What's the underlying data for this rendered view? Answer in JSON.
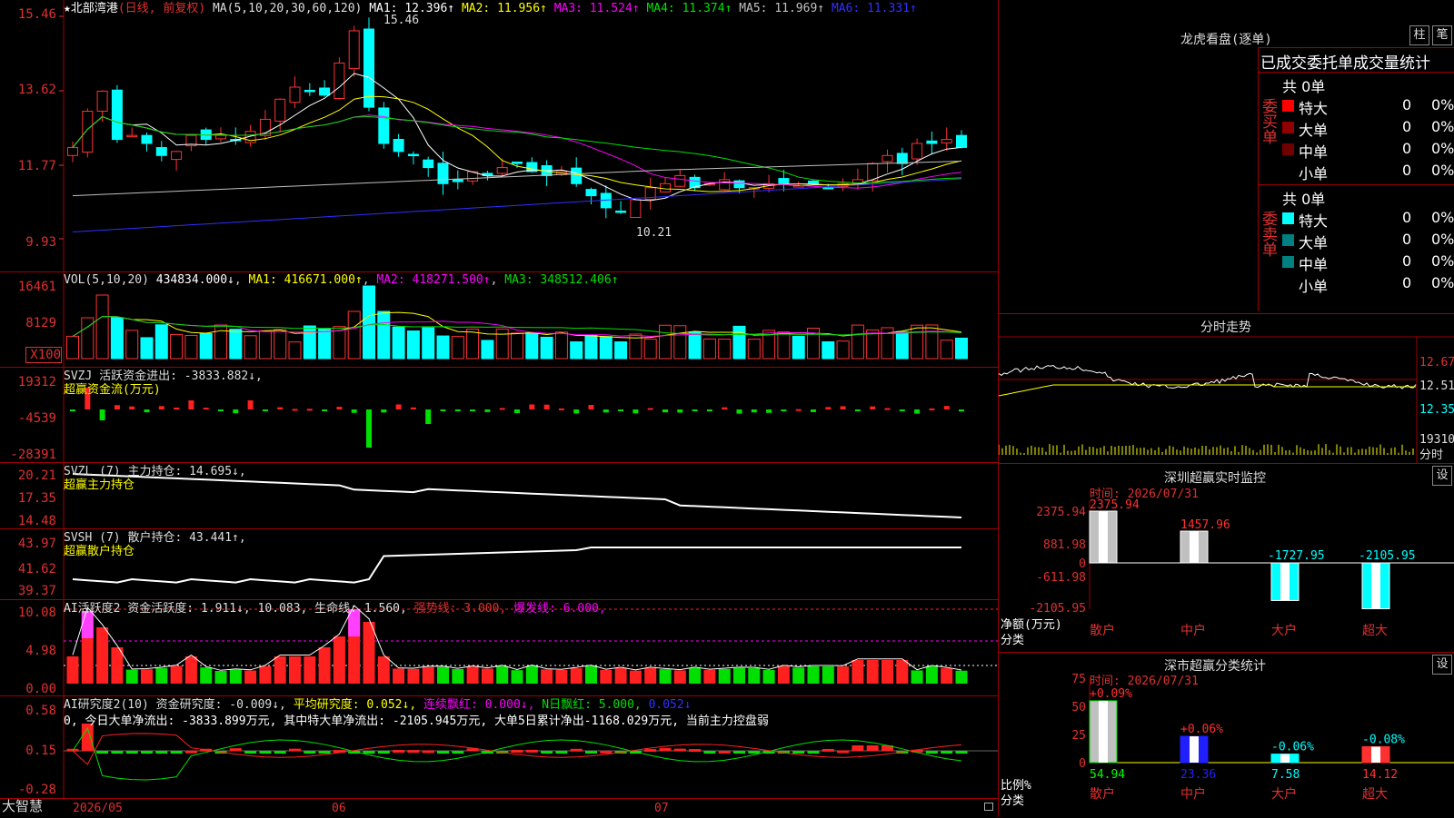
{
  "main": {
    "stock_name": "北部湾港",
    "mode": "(日线, 前复权)",
    "ma_title": "MA(5,10,20,30,60,120)",
    "ma": [
      {
        "label": "MA1: 12.396↑",
        "color": "#ffffff"
      },
      {
        "label": "MA2: 11.956↑",
        "color": "#ffff00"
      },
      {
        "label": "MA3: 11.524↑",
        "color": "#ff00ff"
      },
      {
        "label": "MA4: 11.374↑",
        "color": "#00e000"
      },
      {
        "label": "MA5: 11.969↑",
        "color": "#c0c0c0"
      },
      {
        "label": "MA6: 11.331↑",
        "color": "#3030ff"
      }
    ],
    "y_ticks": [
      "15.46",
      "13.62",
      "11.77",
      "9.93"
    ],
    "high_label": "15.46",
    "low_label": "10.21"
  },
  "vol": {
    "title": "VOL(5,10,20)",
    "value": "434834.000↓",
    "ma1": "MA1: 416671.000↑",
    "ma2": "MA2: 418271.500↑",
    "ma3": "MA3: 348512.406↑",
    "y_ticks": [
      "16461",
      "8129",
      "X100"
    ]
  },
  "svzj": {
    "title": "SVZJ  活跃资金进出: -3833.882↓,",
    "subtitle": "超赢资金流(万元)",
    "y_ticks": [
      "19312",
      "-4539",
      "-28391"
    ]
  },
  "svzl": {
    "title": "SVZL (7) 主力持仓: 14.695↓,",
    "subtitle": "超赢主力持仓",
    "y_ticks": [
      "20.21",
      "17.35",
      "14.48"
    ]
  },
  "svsh": {
    "title": "SVSH (7) 散户持仓: 43.441↑,",
    "subtitle": "超赢散户持仓",
    "y_ticks": [
      "43.97",
      "41.62",
      "39.37"
    ]
  },
  "ai1": {
    "title": "AI活跃度2 资金活跃度: 1.911↓, 10.083, 生命线: 1.560,",
    "strong": "强势线: 3.000,",
    "burst": "爆发线: 6.000,",
    "y_ticks": [
      "10.08",
      "4.98",
      "0.00"
    ]
  },
  "ai2": {
    "title": "AI研究度2(10) 资金研究度: -0.009↓,",
    "avg": "平均研究度: 0.052↓,",
    "red": "连续飘红: 0.000↓,",
    "nred": "N日飘红: 5.000,",
    "last": "0.052↓",
    "desc": "0, 今日大单净流出: -3833.899万元, 其中特大单净流出: -2105.945万元, 大单5日累计净出-1168.029万元, 当前主力控盘弱",
    "y_ticks": [
      "0.58",
      "0.15",
      "-0.28"
    ]
  },
  "axis": {
    "brand": "大智慧",
    "dates": [
      "2026/05",
      "06",
      "07"
    ]
  },
  "right": {
    "lhb_title": "龙虎看盘(逐单)",
    "btn_zhu": "柱",
    "btn_bi": "笔",
    "stats_title": "已成交委托单成交量统计",
    "buy_label": "委买单",
    "sell_label": "委卖单",
    "buy_total": "共 0单",
    "sell_total": "共 0单",
    "buy_rows": [
      {
        "name": "特大",
        "n": "0",
        "p": "0%",
        "color": "#ff0000"
      },
      {
        "name": "大单",
        "n": "0",
        "p": "0%",
        "color": "#900000"
      },
      {
        "name": "中单",
        "n": "0",
        "p": "0%",
        "color": "#700000"
      },
      {
        "name": "小单",
        "n": "0",
        "p": "0%",
        "color": "#000000"
      }
    ],
    "sell_rows": [
      {
        "name": "特大",
        "n": "0",
        "p": "0%",
        "color": "#00ffff"
      },
      {
        "name": "大单",
        "n": "0",
        "p": "0%",
        "color": "#008080"
      },
      {
        "name": "中单",
        "n": "0",
        "p": "0%",
        "color": "#008080"
      },
      {
        "name": "小单",
        "n": "0",
        "p": "0%",
        "color": "#000000"
      }
    ],
    "intraday_title": "分时走势",
    "intraday_ticks": [
      "12.67",
      "12.51",
      "12.35"
    ],
    "intraday_vol": "19310",
    "intraday_label": "分时",
    "sz_title": "深圳超赢实时监控",
    "btn_set": "设",
    "sz_time": "时间: 2026/07/31",
    "sz_y": [
      "2375.94",
      "881.98",
      "0",
      "-611.98",
      "-2105.95"
    ],
    "sz_ylabel": "净额(万元)",
    "sz_xlabel": "分类",
    "sz_cats": [
      "散户",
      "中户",
      "大户",
      "超大"
    ],
    "sz_values": [
      "2375.94",
      "1457.96",
      "-1727.95",
      "-2105.95"
    ],
    "cls_title": "深市超赢分类统计",
    "cls_time": "时间: 2026/07/31",
    "cls_y": [
      "75",
      "50",
      "25",
      "0"
    ],
    "cls_ylabel": "比例%",
    "cls_xlabel": "分类",
    "cls_pct": [
      "+0.09%",
      "+0.06%",
      "-0.06%",
      "-0.08%"
    ],
    "cls_vals": [
      "54.94",
      "23.36",
      "7.58",
      "14.12"
    ],
    "cls_cats": [
      "散户",
      "中户",
      "大户",
      "超大"
    ]
  }
}
